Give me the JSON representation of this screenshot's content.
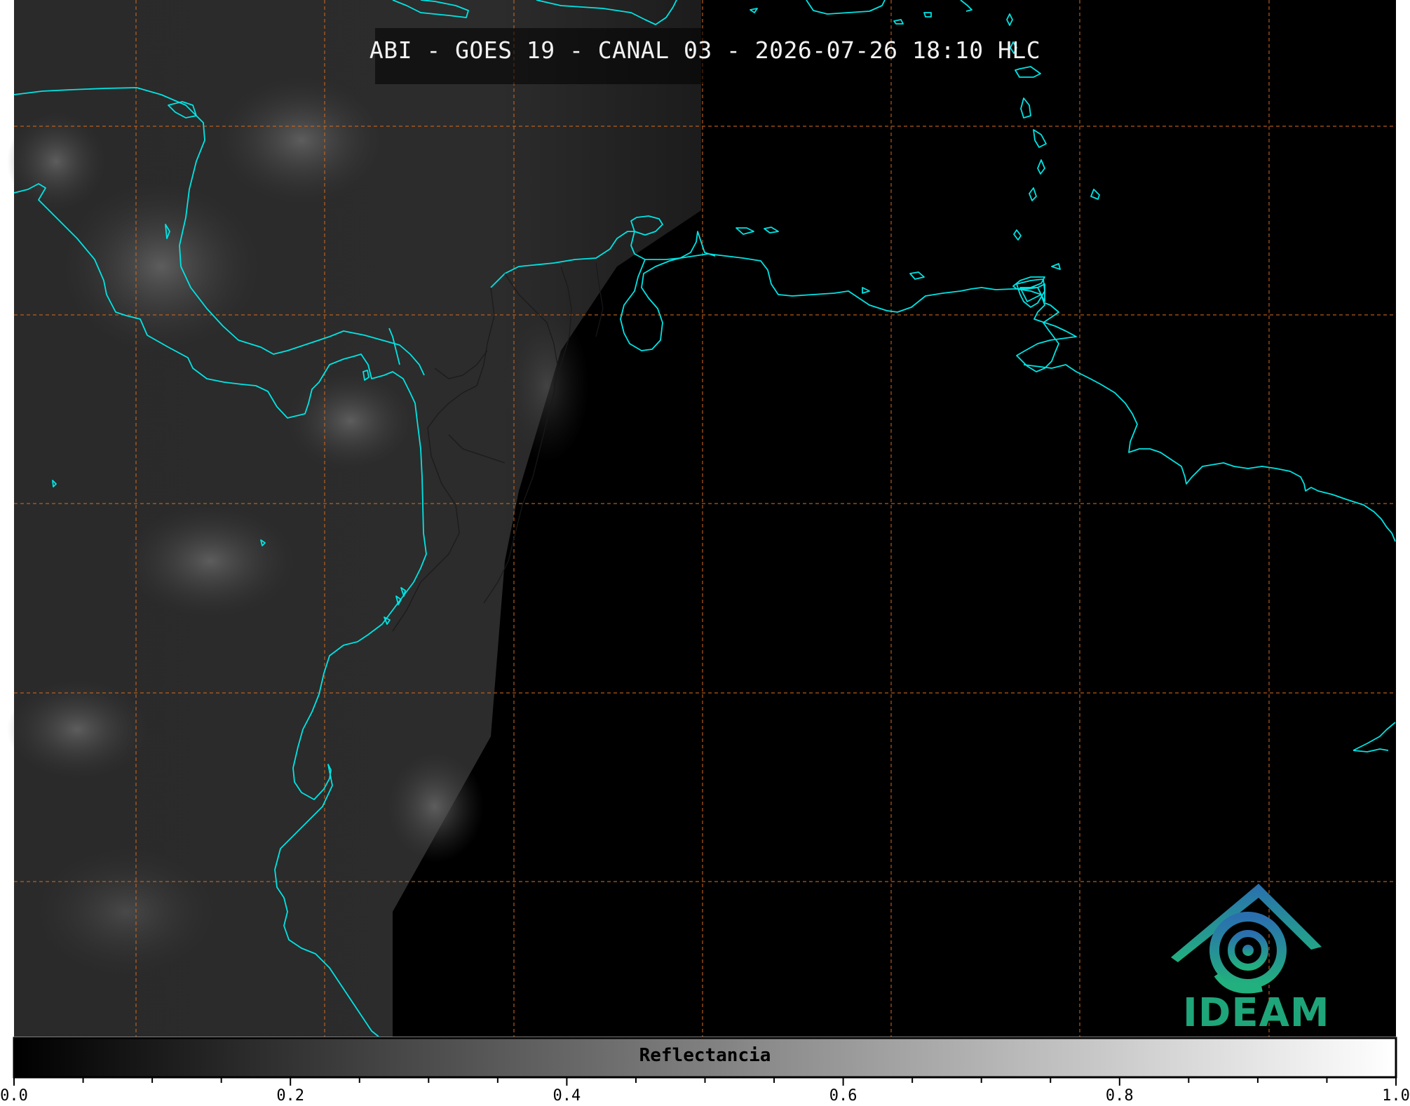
{
  "title": "ABI - GOES 19 - CANAL 03 - 2026-07-26 18:10 HLC",
  "colorbar": {
    "label": "Reflectancia",
    "ticks": [
      "0.0",
      "0.2",
      "0.4",
      "0.6",
      "0.8",
      "1.0"
    ],
    "range": [
      0.0,
      1.0
    ],
    "colormap": "grayscale"
  },
  "logo": {
    "text": "IDEAM",
    "color": "#1ea57a",
    "icon": "ideam-logo-icon"
  },
  "map": {
    "coastline_color": "#00e5e5",
    "grid_color": "#d2691e",
    "background": "#000000"
  }
}
